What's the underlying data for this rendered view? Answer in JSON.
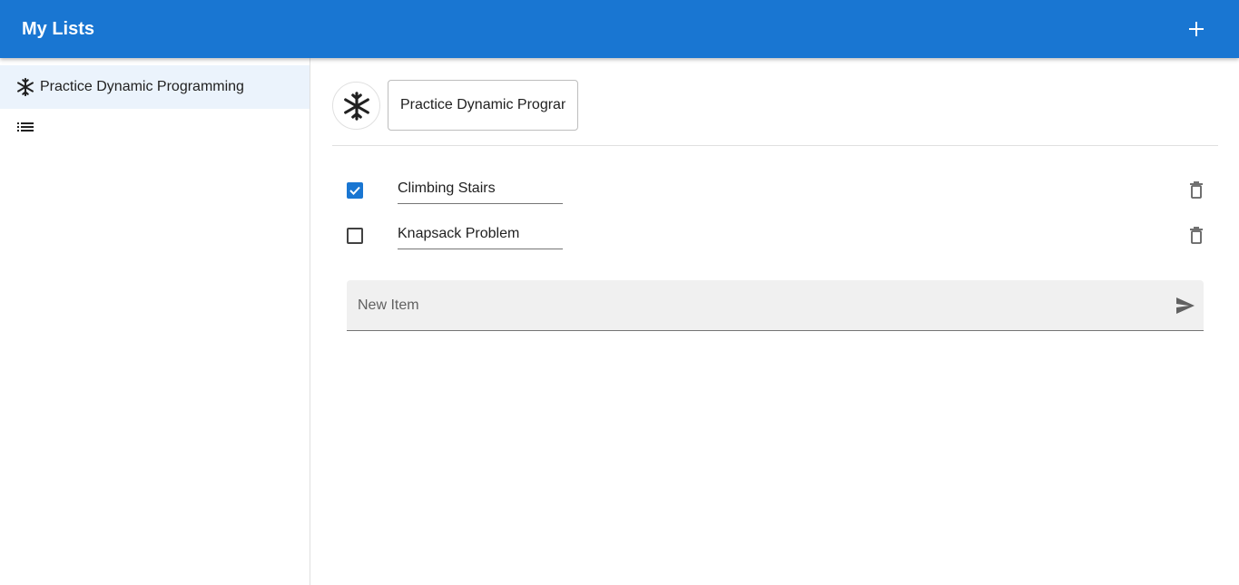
{
  "appbar": {
    "title": "My Lists",
    "add_icon": "plus-icon",
    "color": "#1976d2"
  },
  "sidebar": {
    "items": [
      {
        "label": "Practice Dynamic Programming",
        "icon": "snowflake-icon",
        "selected": true
      },
      {
        "label": "",
        "icon": "list-icon",
        "selected": false
      }
    ]
  },
  "main": {
    "list_icon": "snowflake-icon",
    "list_title": "Practice Dynamic Programming",
    "todos": [
      {
        "text": "Climbing Stairs",
        "checked": true
      },
      {
        "text": "Knapsack Problem",
        "checked": false
      }
    ],
    "new_item": {
      "placeholder": "New Item",
      "value": ""
    }
  },
  "colors": {
    "accent": "#1976d2",
    "selected_bg": "#ebf3fc",
    "input_bg": "#f0f0f0"
  }
}
